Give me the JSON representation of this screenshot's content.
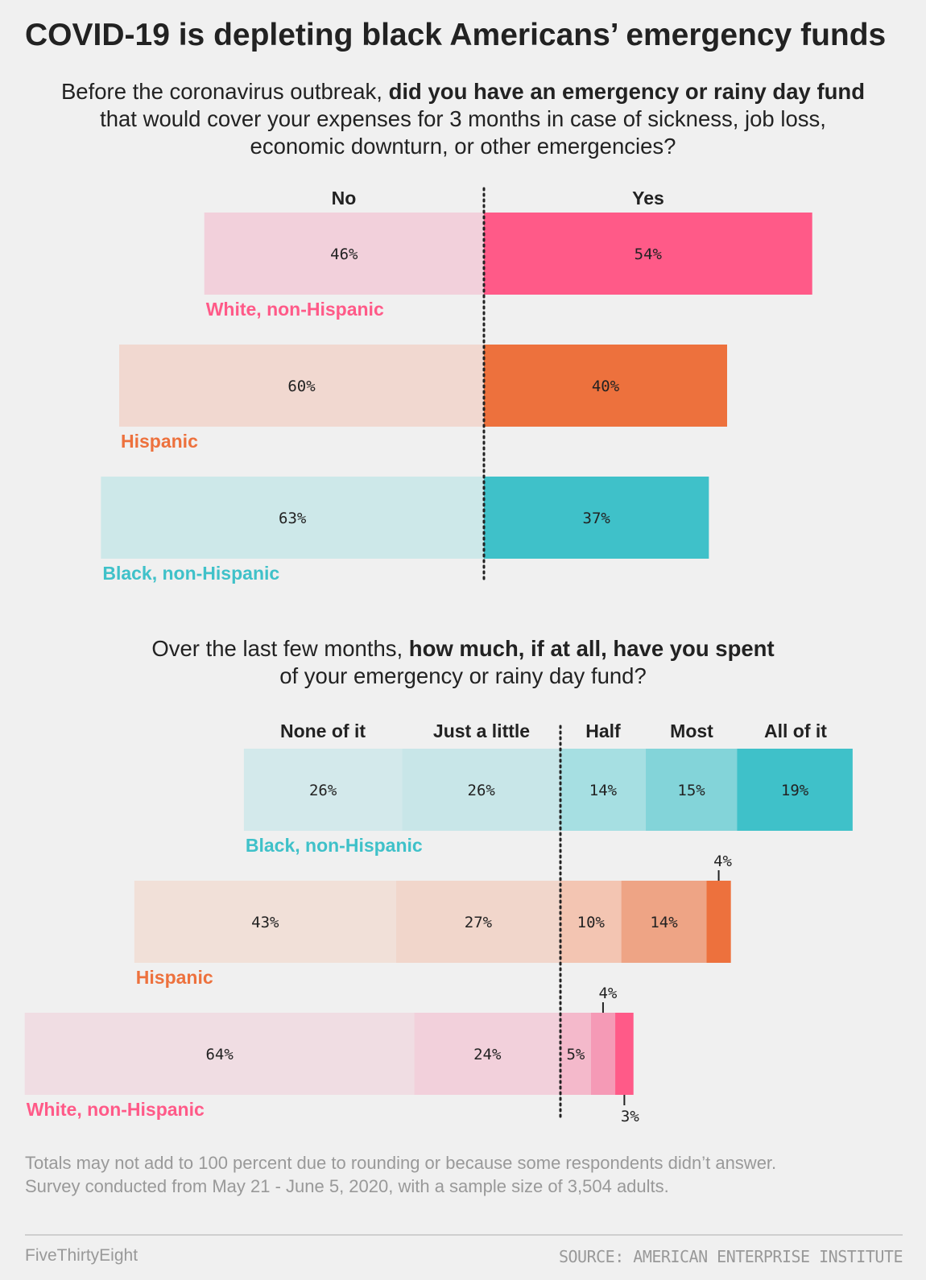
{
  "title": "COVID-19 is depleting black Americans’ emergency funds",
  "question1": {
    "pre": "Before the coronavirus outbreak, ",
    "bold": "did you have an emergency or rainy day fund",
    "post": " that would cover your expenses for 3 months in case of sickness, job loss, economic downturn, or other emergencies?"
  },
  "question2": {
    "pre": "Over the last few months, ",
    "bold": "how much, if at all, have you spent",
    "post": " of your emergency or rainy day fund?"
  },
  "footnote": {
    "line1": "Totals may not add to 100 percent due to rounding or because some respondents didn’t answer.",
    "line2": "Survey conducted from May 21 - June 5, 2020, with a sample size of 3,504 adults."
  },
  "brand": "FiveThirtyEight",
  "source": "SOURCE: AMERICAN ENTERPRISE INSTITUTE",
  "chart_data": [
    {
      "type": "bar",
      "orientation": "horizontal-diverging",
      "categories": [
        "No",
        "Yes"
      ],
      "groups": [
        {
          "name": "White, non-Hispanic",
          "values": [
            46,
            54
          ],
          "labels": [
            "46%",
            "54%"
          ],
          "colors": [
            "#f2d0db",
            "#ff5a88"
          ]
        },
        {
          "name": "Hispanic",
          "values": [
            60,
            40
          ],
          "labels": [
            "60%",
            "40%"
          ],
          "colors": [
            "#f1d8d0",
            "#ed713d"
          ]
        },
        {
          "name": "Black, non-Hispanic",
          "values": [
            63,
            37
          ],
          "labels": [
            "63%",
            "37%"
          ],
          "colors": [
            "#cde8e9",
            "#3fc1c9"
          ]
        }
      ]
    },
    {
      "type": "bar",
      "orientation": "horizontal-stacked-diverging",
      "categories": [
        "None of it",
        "Just a little",
        "Half",
        "Most",
        "All of it"
      ],
      "groups": [
        {
          "name": "Black, non-Hispanic",
          "values": [
            26,
            26,
            14,
            15,
            19
          ],
          "labels": [
            "26%",
            "26%",
            "14%",
            "15%",
            "19%"
          ],
          "colors": [
            "#d3e9eb",
            "#c8e6e8",
            "#a6dfe2",
            "#83d4d9",
            "#3fc1c9"
          ],
          "name_color": "#3fc1c9"
        },
        {
          "name": "Hispanic",
          "values": [
            43,
            27,
            10,
            14,
            4
          ],
          "labels": [
            "43%",
            "27%",
            "10%",
            "14%",
            "4%"
          ],
          "colors": [
            "#f1e0d8",
            "#f1d6cb",
            "#f3c5b2",
            "#eea485",
            "#ed713d"
          ],
          "name_color": "#ed713d"
        },
        {
          "name": "White, non-Hispanic",
          "values": [
            64,
            24,
            5,
            4,
            3
          ],
          "labels": [
            "64%",
            "24%",
            "5%",
            "4%",
            "3%"
          ],
          "colors": [
            "#f0dde3",
            "#f2d0db",
            "#f4b9cb",
            "#f59ab6",
            "#ff5a88"
          ],
          "name_color": "#ff5a88"
        }
      ]
    }
  ]
}
